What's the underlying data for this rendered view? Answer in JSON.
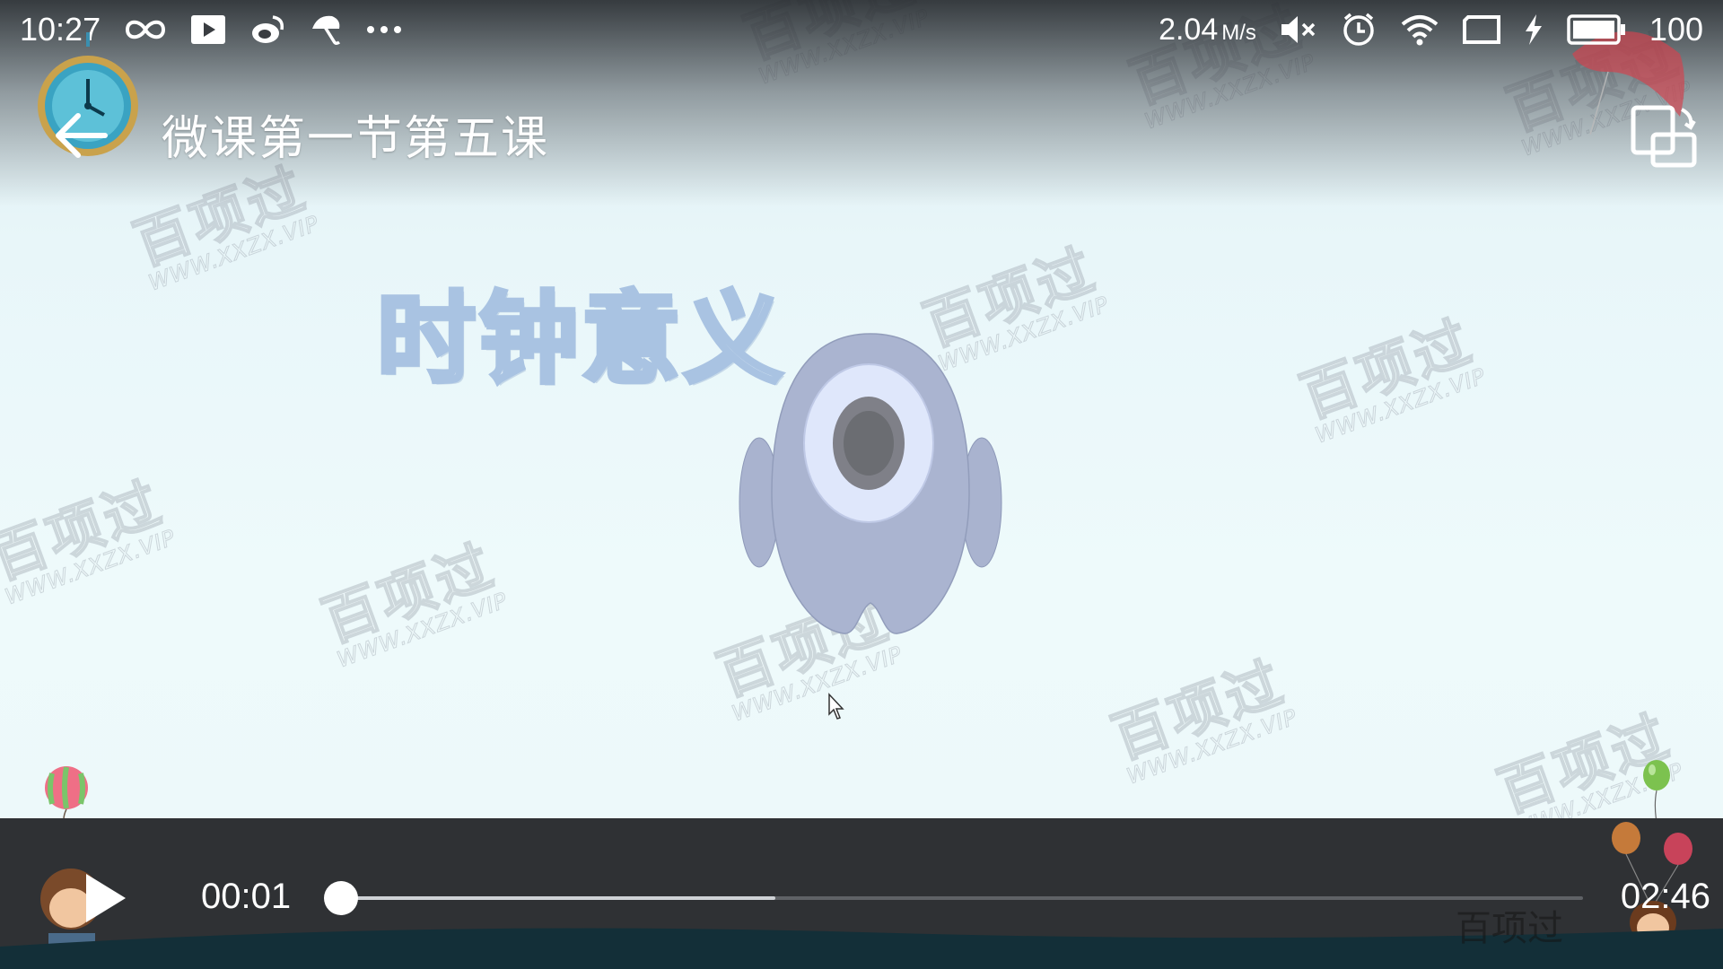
{
  "status_bar": {
    "time": "10:27",
    "net_speed_value": "2.04",
    "net_speed_unit": "M/s",
    "battery": "100",
    "icons": [
      "infinity-icon",
      "youtube-icon",
      "weibo-icon",
      "umbrella-icon",
      "more-icon",
      "mute-icon",
      "alarm-icon",
      "wifi-icon",
      "sim-icon",
      "charging-icon",
      "battery-icon"
    ]
  },
  "header": {
    "title": "微课第一节第五课",
    "back_icon": "back-arrow-icon",
    "rotate_icon": "rotate-screen-icon"
  },
  "video": {
    "heading": "时钟意义",
    "watermark_cn": "百项过",
    "watermark_url": "WWW.XXZX.VIP",
    "bottom_watermark": "百项过"
  },
  "player": {
    "current_time": "00:01",
    "total_time": "02:46",
    "progress": 0.0,
    "buffered": 0.35,
    "play_icon": "play-icon",
    "colors": {
      "bar": "#2f3134",
      "thumb": "#ffffff",
      "buffer": "#cfd2d6",
      "track": "#5f6266"
    }
  }
}
